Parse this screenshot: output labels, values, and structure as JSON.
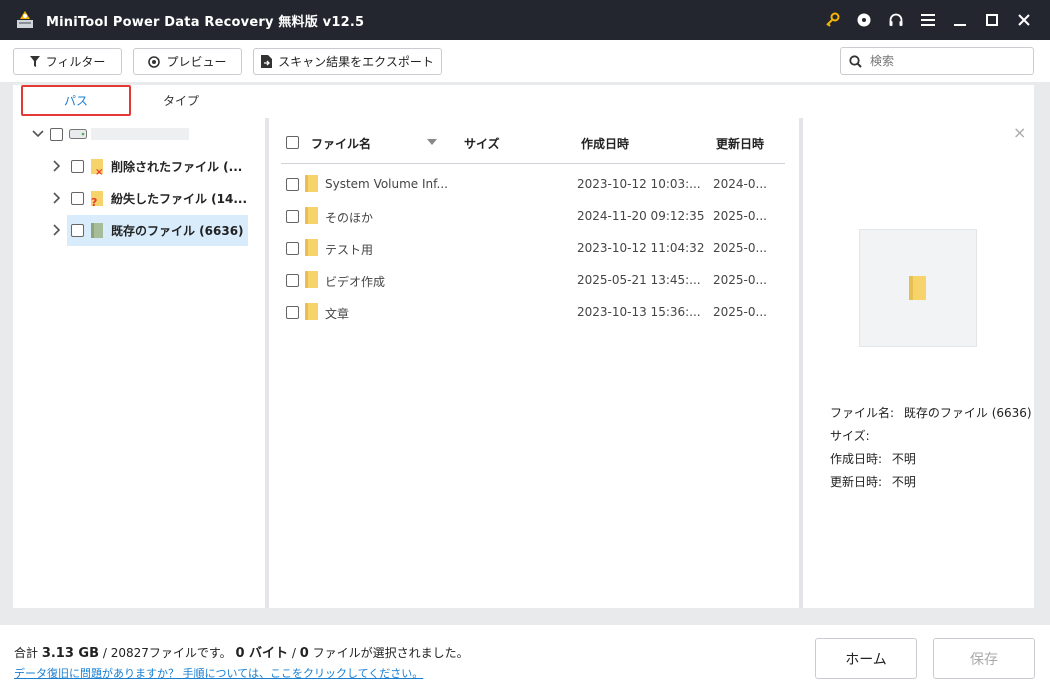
{
  "titlebar": {
    "title": "MiniTool Power Data Recovery 無料版 v12.5"
  },
  "toolbar": {
    "filter_label": "フィルター",
    "preview_label": "プレビュー",
    "export_label": "スキャン結果をエクスポート",
    "search_placeholder": "検索"
  },
  "tabs": {
    "path": "パス",
    "type": "タイプ"
  },
  "tree": {
    "items": [
      {
        "label": "削除されたファイル (..."
      },
      {
        "label": "紛失したファイル (14..."
      },
      {
        "label": "既存のファイル (6636)"
      }
    ]
  },
  "list": {
    "headers": {
      "name": "ファイル名",
      "size": "サイズ",
      "created": "作成日時",
      "modified": "更新日時"
    },
    "rows": [
      {
        "name": "System Volume Inf...",
        "size": "",
        "created": "2023-10-12 10:03:...",
        "modified": "2024-0..."
      },
      {
        "name": "そのほか",
        "size": "",
        "created": "2024-11-20 09:12:35",
        "modified": "2025-0..."
      },
      {
        "name": "テスト用",
        "size": "",
        "created": "2023-10-12 11:04:32",
        "modified": "2025-0..."
      },
      {
        "name": "ビデオ作成",
        "size": "",
        "created": "2025-05-21 13:45:...",
        "modified": "2025-0..."
      },
      {
        "name": "文章",
        "size": "",
        "created": "2023-10-13 15:36:...",
        "modified": "2025-0..."
      }
    ]
  },
  "preview": {
    "close": "×",
    "name_label": "ファイル名:",
    "name_value": "既存のファイル (6636)",
    "size_label": "サイズ:",
    "size_value": "",
    "created_label": "作成日時:",
    "created_value": "不明",
    "modified_label": "更新日時:",
    "modified_value": "不明"
  },
  "bottom": {
    "summary_prefix": "合計 ",
    "total_size": "3.13 GB",
    "summary_mid": " / 20827ファイルです。 ",
    "selected_size": "0 バイト",
    "summary_mid2": " / ",
    "selected_count": "0",
    "summary_suffix": " ファイルが選択されました。",
    "help_link": "データ復旧に問題がありますか？ 手順については、ここをクリックしてください。",
    "home_label": "ホーム",
    "save_label": "保存"
  },
  "colors": {
    "titlebar_bg": "#23262f",
    "accent": "#1a7fd1",
    "highlight_border": "#e53935",
    "selected_row": "#d9ecfb",
    "key_icon": "#f5b400"
  }
}
